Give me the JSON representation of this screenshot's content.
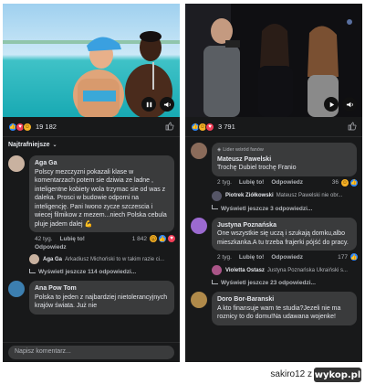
{
  "left": {
    "reaction_count": "19 182",
    "sort_label": "Najtrafniejsze",
    "comments": [
      {
        "author": "Aga Ga",
        "text": "Polscy mezczyzni pokazali klase w komentarzach potem sie dziwia ze ladne , inteligentne kobiety wola trzymac sie od was z daleka. Prosci w budowie odporni na inteligencję. Pani Iwono zycze szczescia i wiecej filmikow z mezem...niech Polska cebula pluje jadem dalej 💪",
        "time": "42 tyg.",
        "like": "Lubię to!",
        "reply": "Odpowiedz",
        "reactions": "1 842"
      },
      {
        "author": "Ana Pow Tom",
        "text": "Polska to jeden z najbardziej nietolerancyjnych krajów świata. Już nie"
      }
    ],
    "reply_preview_author": "Aga Ga",
    "reply_preview_text": "Arkadiusz Michoński to w takim razie ci...",
    "view_more": "Wyświetl jeszcze 114 odpowiedzi...",
    "input_placeholder": "Napisz komentarz..."
  },
  "right": {
    "reaction_count": "3 791",
    "comments": [
      {
        "badge": "Lider wśród fanów",
        "author": "Mateusz Pawelski",
        "text": "Trochę Dubiel trochę Franio",
        "time": "2 tyg.",
        "like": "Lubię to!",
        "reply": "Odpowiedz",
        "reactions": "36"
      },
      {
        "author": "Justyna Poznańska",
        "text": "One wszystkie się uczą i szukają domku,albo mieszkanka.A tu trzeba frajerki pójść do pracy.",
        "time": "2 tyg.",
        "like": "Lubię to!",
        "reply": "Odpowiedz",
        "reactions": "177"
      },
      {
        "author": "Doro Bor-Baranski",
        "text": "A kto finansuje wam te studia?Jezeli nie ma roznicy to do domu!Na udawana wojenke!"
      }
    ],
    "reply1_author": "Piotrek Ziółkowski",
    "reply1_text": "Mateusz Pawelski  nie obr...",
    "view_more1": "Wyświetl jeszcze 3 odpowiedzi...",
    "reply2_author": "Violetta Ostasz",
    "reply2_text": "Justyna Poznańska Ukraiński s...",
    "view_more2": "Wyświetl jeszcze 23 odpowiedzi..."
  },
  "footer": {
    "credit": "sakiro12  z",
    "logo": "wykop.pl"
  },
  "colors": {
    "panel_bg": "#18191a",
    "bubble_bg": "#3a3b3c",
    "like_blue": "#2d88ff",
    "love_red": "#f33e58",
    "haha_yellow": "#f7b125"
  }
}
